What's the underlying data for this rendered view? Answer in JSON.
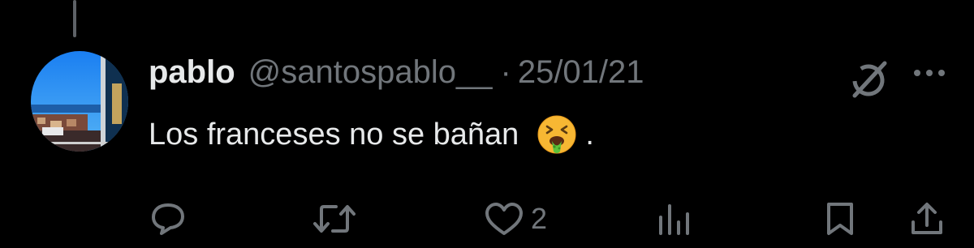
{
  "tweet": {
    "author": {
      "display_name": "pablo",
      "handle": "@santospablo__"
    },
    "separator": "·",
    "date": "25/01/21",
    "text": "Los franceses no se bañan",
    "emoji_icon": "nauseated-face-emoji",
    "text_suffix": ".",
    "actions": {
      "reply": {
        "icon": "reply-icon"
      },
      "retweet": {
        "icon": "retweet-icon"
      },
      "like": {
        "icon": "heart-icon",
        "count": "2"
      },
      "views": {
        "icon": "views-icon"
      },
      "bookmark": {
        "icon": "bookmark-icon"
      },
      "share": {
        "icon": "share-icon"
      }
    }
  },
  "colors": {
    "background": "#000000",
    "primary_text": "#e7e9ea",
    "secondary_text": "#71767b",
    "thread_line": "#5e6267"
  }
}
